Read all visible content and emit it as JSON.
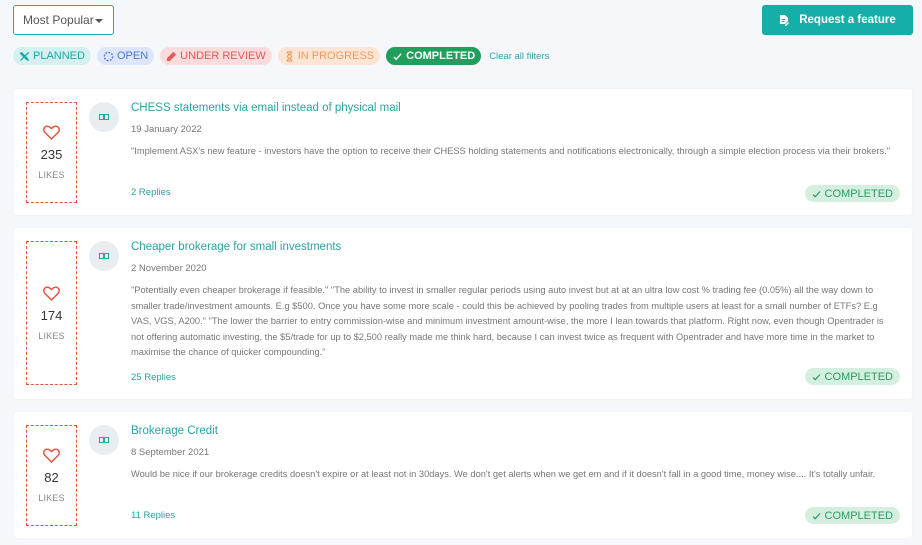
{
  "toolbar": {
    "sort_value": "Most Popular",
    "request_button": "Request a feature"
  },
  "filters": {
    "chips": [
      {
        "label": "PLANNED",
        "icon": "tools-icon"
      },
      {
        "label": "OPEN",
        "icon": "circle-dashed-icon"
      },
      {
        "label": "UNDER REVIEW",
        "icon": "pencil-icon"
      },
      {
        "label": "IN PROGRESS",
        "icon": "hourglass-icon"
      },
      {
        "label": "COMPLETED",
        "icon": "check-icon",
        "active": true
      }
    ],
    "clear_label": "Clear all filters"
  },
  "posts": [
    {
      "likes": "235",
      "likes_label": "LIKES",
      "title": "CHESS statements via email instead of physical mail",
      "date": "19 January 2022",
      "body": "\"Implement ASX's new feature - investors have the option to receive their CHESS holding statements and notifications electronically, through a simple election process via their brokers.\"",
      "replies": "2 Replies",
      "status": "COMPLETED"
    },
    {
      "likes": "174",
      "likes_label": "LIKES",
      "title": "Cheaper brokerage for small investments",
      "date": "2 November 2020",
      "body": "\"Potentially even cheaper brokerage if feasible.\" \"The ability to invest in smaller regular periods using auto invest but at at an ultra low cost % trading fee (0.05%) all the way down to smaller trade/investment amounts. E.g $500. Once you have some more scale - could this be achieved by pooling trades from multiple users at least for a small number of ETFs? E.g VAS, VGS, A200.\" \"The lower the barrier to entry commission-wise and minimum investment amount-wise, the more I lean towards that platform. Right now, even though Opentrader is not offering automatic investing, the $5/trade for up to $2,500 really made me think hard, because I can invest twice as frequent with Opentrader and have more time in the market to maximise the chance of quicker compounding.\"",
      "replies": "25 Replies",
      "status": "COMPLETED"
    },
    {
      "likes": "82",
      "likes_label": "LIKES",
      "title": "Brokerage Credit",
      "date": "8 September 2021",
      "body": "Would be nice if our brokerage credits doesn't expire or at least not in 30days. We don't get alerts when we get em and if it doesn't fall in a good time, money wise.... It's totally unfair.",
      "replies": "11 Replies",
      "status": "COMPLETED"
    }
  ],
  "colors": {
    "accent": "#17aeaa",
    "completed": "#1f9e5c",
    "like": "#e2553f"
  }
}
